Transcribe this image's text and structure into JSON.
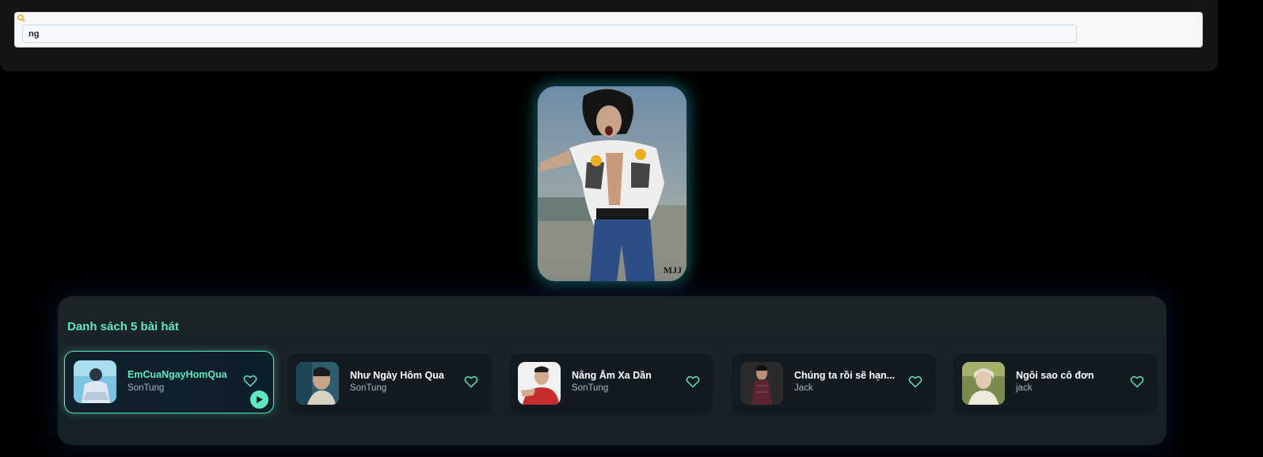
{
  "search": {
    "value": "ng",
    "icon": "search-icon"
  },
  "cover": {
    "watermark": "MJJ"
  },
  "playlist": {
    "title": "Danh sách 5 bài hát",
    "accent_color": "#5ee8c2",
    "tracks": [
      {
        "title": "EmCuaNgayHomQua",
        "artist": "SonTung",
        "active": true
      },
      {
        "title": "Như Ngày Hôm Qua",
        "artist": "SonTung",
        "active": false
      },
      {
        "title": "Nắng Ấm Xa Dần",
        "artist": "SonTung",
        "active": false
      },
      {
        "title": "Chúng ta rồi sẽ hạn...",
        "artist": "Jack",
        "active": false
      },
      {
        "title": "Ngôi sao cô đơn",
        "artist": "jack",
        "active": false
      }
    ]
  }
}
